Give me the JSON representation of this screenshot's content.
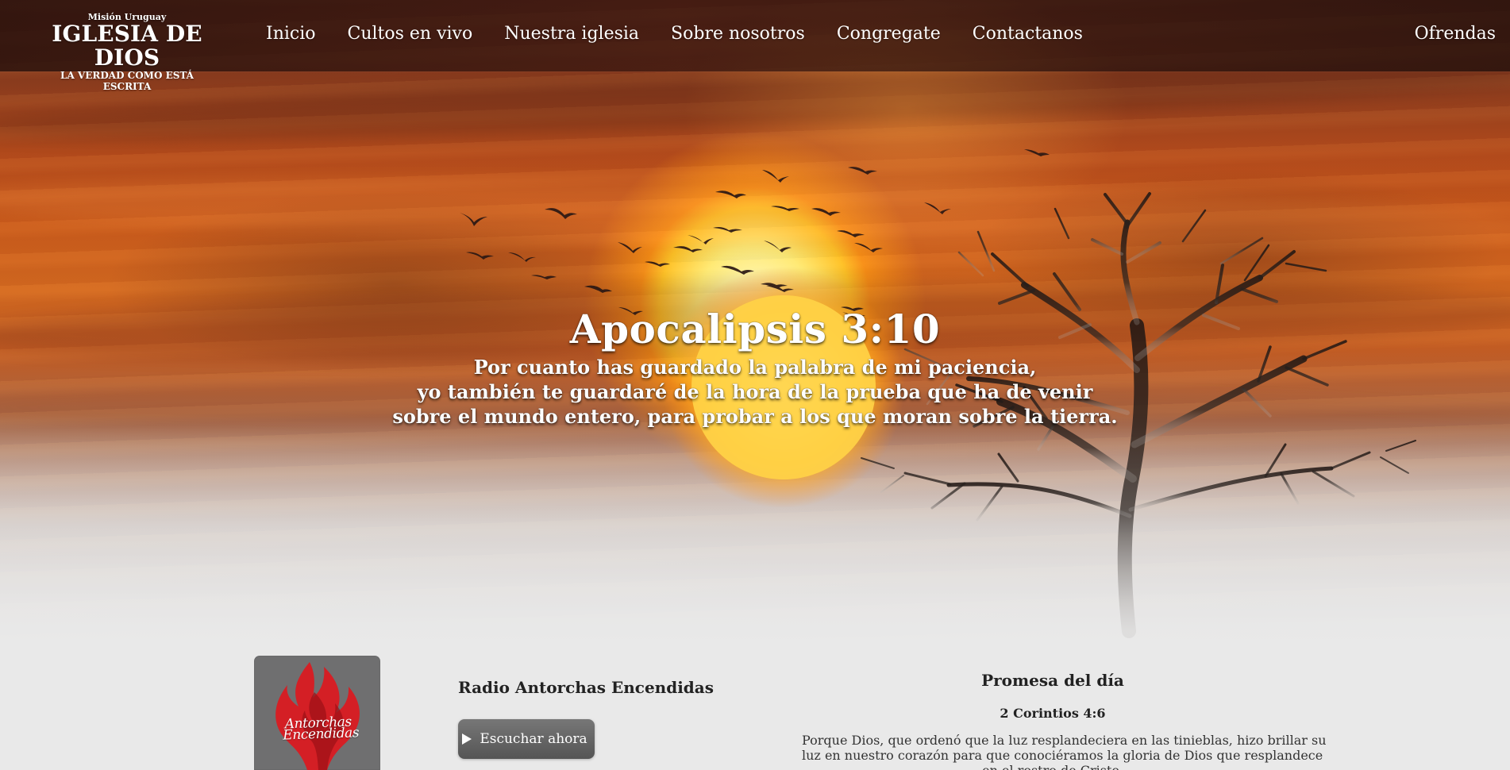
{
  "header": {
    "logo": {
      "mission": "Misión Uruguay",
      "name": "IGLESIA DE DIOS",
      "tagline": "LA VERDAD COMO ESTÁ ESCRITA"
    },
    "nav": [
      {
        "label": "Inicio"
      },
      {
        "label": "Cultos en vivo"
      },
      {
        "label": "Nuestra iglesia"
      },
      {
        "label": "Sobre nosotros"
      },
      {
        "label": "Congregate"
      },
      {
        "label": "Contactanos"
      }
    ],
    "offerings_label": "Ofrendas"
  },
  "hero": {
    "reference": "Apocalipsis 3:10",
    "lines": [
      "Por cuanto has guardado la palabra de mi paciencia,",
      "yo también te guardaré de la hora de la prueba que ha de venir",
      "sobre el mundo entero, para probar a los que moran sobre la tierra."
    ],
    "image_elements": {
      "sun": "sun",
      "birds": "flock-of-birds",
      "tree": "bare-tree"
    }
  },
  "radio": {
    "logo_text": {
      "line1": "Antorchas",
      "line2": "Encendidas"
    },
    "title": "Radio Antorchas Encendidas",
    "button_label": "Escuchar ahora",
    "icon": "play-icon"
  },
  "promise": {
    "title": "Promesa del día",
    "reference": "2 Corintios 4:6",
    "lines": [
      "Porque Dios, que ordenó que la luz resplandeciera en las tinieblas, hizo brillar su",
      "luz en nuestro corazón para que conociéramos la gloria de Dios que resplandece",
      "en el rostro de Cristo."
    ]
  },
  "colors": {
    "nav_overlay": "#2d130e",
    "sky_red": "#b64c1c",
    "sun_yellow": "#ffe37a",
    "radio_logo_gray": "#6f6f70",
    "flame_red": "#d41f25",
    "button_gray": "#666666",
    "page_background": "#e9e9e9"
  }
}
